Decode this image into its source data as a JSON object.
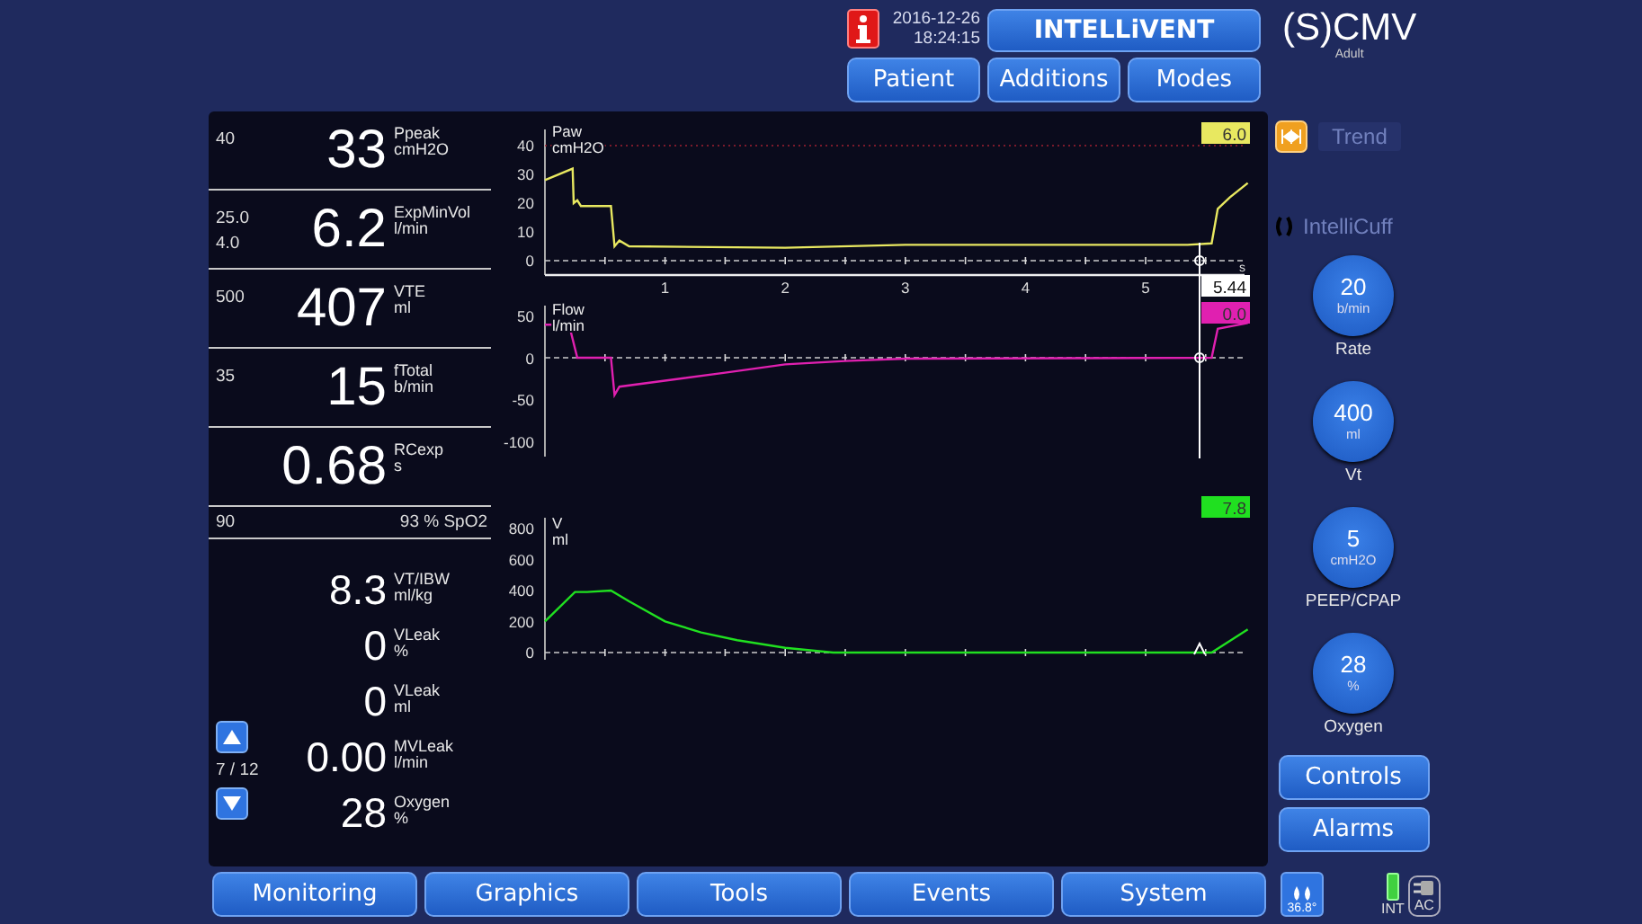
{
  "top_bar": {
    "date": "2016-12-26",
    "time": "18:24:15",
    "mode_button": {
      "label": "INTELLiVENT"
    },
    "nav_buttons": [
      {
        "label": "Patient"
      },
      {
        "label": "Additions"
      },
      {
        "label": "Modes"
      }
    ],
    "ventilation_mode": "(S)CMV",
    "patient_group": "Adult"
  },
  "monitoring": {
    "main_params": [
      {
        "limits": [
          "40"
        ],
        "value": "33",
        "name": "Ppeak",
        "unit": "cmH2O"
      },
      {
        "limits": [
          "25.0",
          "4.0"
        ],
        "value": "6.2",
        "name": "ExpMinVol",
        "unit": "l/min"
      },
      {
        "limits": [
          "500"
        ],
        "value": "407",
        "name": "VTE",
        "unit": "ml"
      },
      {
        "limits": [
          "35"
        ],
        "value": "15",
        "name": "fTotal",
        "unit": "b/min"
      },
      {
        "value": "0.68",
        "name": "RCexp",
        "unit": "s"
      }
    ],
    "spo2": {
      "limit": "90",
      "reading": "93 % SpO2"
    },
    "secondary_params": [
      {
        "value": "8.3",
        "name": "VT/IBW",
        "unit": "ml/kg"
      },
      {
        "value": "0",
        "name": "VLeak",
        "unit": "%"
      },
      {
        "value": "0",
        "name": "VLeak",
        "unit": "ml"
      },
      {
        "value": "0.00",
        "name": "MVLeak",
        "unit": "l/min"
      },
      {
        "value": "28",
        "name": "Oxygen",
        "unit": "%"
      }
    ],
    "pager": "7 / 12"
  },
  "charts": [
    {
      "label": "Paw",
      "unit": "cmH2O",
      "y_labels": [
        "40",
        "30",
        "20",
        "10",
        "0"
      ],
      "cursor_value": "6.0",
      "color": "#e8e860",
      "x_labels": [
        "1",
        "2",
        "3",
        "4",
        "5"
      ],
      "x_unit": "s",
      "cursor_time": "5.44"
    },
    {
      "label": "Flow",
      "unit": "l/min",
      "y_labels": [
        "50",
        "0",
        "-50",
        "-100"
      ],
      "cursor_value": "0.0",
      "color": "#e020b0"
    },
    {
      "label": "V",
      "unit": "ml",
      "y_labels": [
        "800",
        "600",
        "400",
        "200",
        "0"
      ],
      "cursor_value": "7.8",
      "color": "#20e020"
    }
  ],
  "right_panel": {
    "tools": [
      {
        "kind": "trend",
        "label": "Trend",
        "disabled": true
      },
      {
        "kind": "cuff",
        "label": "IntelliCuff",
        "disabled": true
      }
    ],
    "controls": [
      {
        "value": "20",
        "unit": "b/min",
        "label": "Rate"
      },
      {
        "value": "400",
        "unit": "ml",
        "label": "Vt"
      },
      {
        "value": "5",
        "unit": "cmH2O",
        "label": "PEEP/CPAP"
      },
      {
        "value": "28",
        "unit": "%",
        "label": "Oxygen"
      }
    ],
    "buttons": [
      {
        "label": "Controls"
      },
      {
        "label": "Alarms"
      }
    ]
  },
  "bottom_bar": {
    "tabs": [
      {
        "label": "Monitoring"
      },
      {
        "label": "Graphics"
      },
      {
        "label": "Tools"
      },
      {
        "label": "Events"
      },
      {
        "label": "System"
      }
    ],
    "humidifier": "36.8°",
    "power": {
      "battery": "INT",
      "mains": "AC"
    }
  }
}
